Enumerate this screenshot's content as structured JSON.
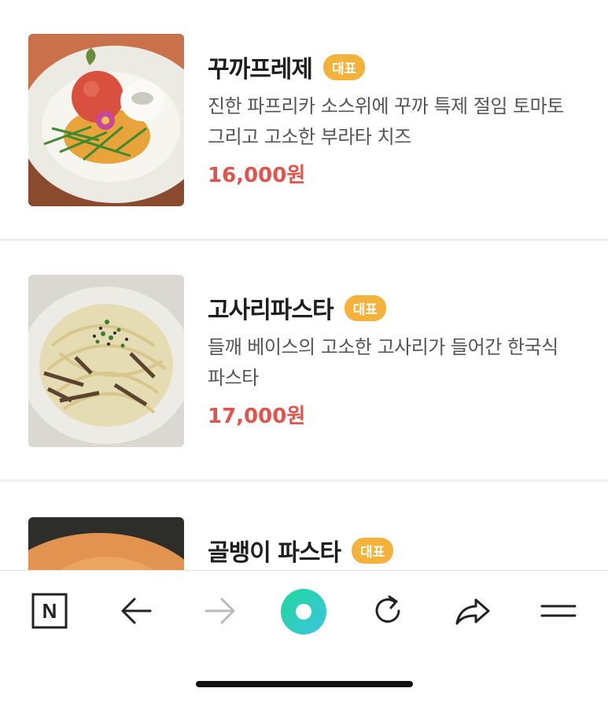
{
  "menu": {
    "items": [
      {
        "name": "꾸까프레제",
        "badge": "대표",
        "description": "진한 파프리카 소스위에 꾸까 특제 절임 토마토 그리고 고소한 부라타 치즈",
        "price": "16,000원"
      },
      {
        "name": "고사리파스타",
        "badge": "대표",
        "description": "들깨 베이스의 고소한 고사리가 들어간 한국식 파스타",
        "price": "17,000원"
      },
      {
        "name": "골뱅이 파스타",
        "badge": "대표"
      }
    ]
  },
  "toolbar": {
    "icons": [
      "naver-home-icon",
      "back-arrow-icon",
      "forward-arrow-icon",
      "green-dot-icon",
      "refresh-icon",
      "share-icon",
      "menu-icon"
    ],
    "logo_letter": "N",
    "accent_color": "#2ecc71",
    "disabled_color": "#bbbbbb"
  },
  "colors": {
    "price": "#e0544b",
    "badge": "#f5b23a"
  }
}
